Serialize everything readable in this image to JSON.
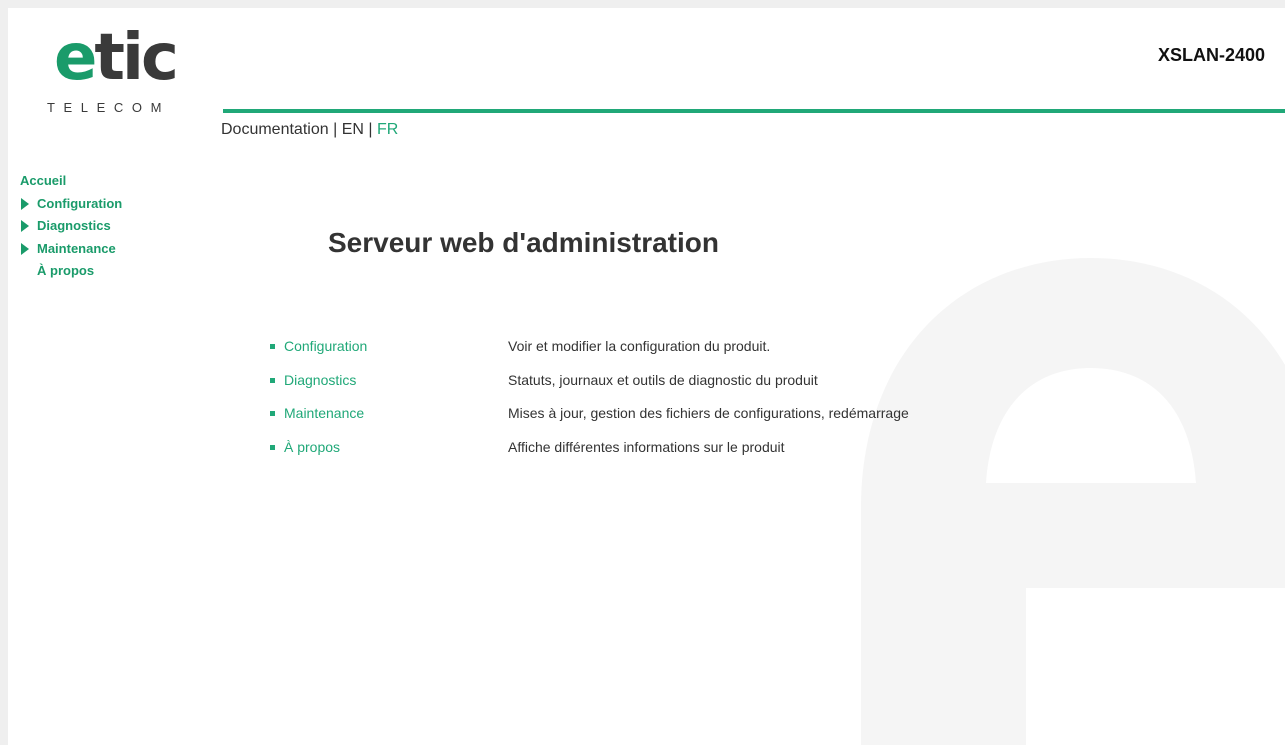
{
  "header": {
    "logo_brand_primary": "e",
    "logo_brand_rest": "tic",
    "logo_sub": "TELECOM",
    "product_name": "XSLAN-2400",
    "documentation_label": "Documentation",
    "separator": "|",
    "lang_en": "EN",
    "lang_fr": "FR"
  },
  "sidebar": {
    "items": [
      {
        "label": "Accueil",
        "type": "home"
      },
      {
        "label": "Configuration",
        "type": "branch"
      },
      {
        "label": "Diagnostics",
        "type": "branch"
      },
      {
        "label": "Maintenance",
        "type": "branch"
      },
      {
        "label": "À propos",
        "type": "plain"
      }
    ]
  },
  "main": {
    "title": "Serveur web d'administration",
    "links": [
      {
        "label": "Configuration",
        "description": "Voir et modifier la configuration du produit."
      },
      {
        "label": "Diagnostics",
        "description": "Statuts, journaux et outils de diagnostic du produit"
      },
      {
        "label": "Maintenance",
        "description": "Mises à jour, gestion des fichiers de configurations, redémarrage"
      },
      {
        "label": "À propos",
        "description": "Affiche différentes informations sur le produit"
      }
    ]
  },
  "colors": {
    "accent": "#20a878",
    "text": "#333333",
    "watermark": "#f4f4f4"
  }
}
